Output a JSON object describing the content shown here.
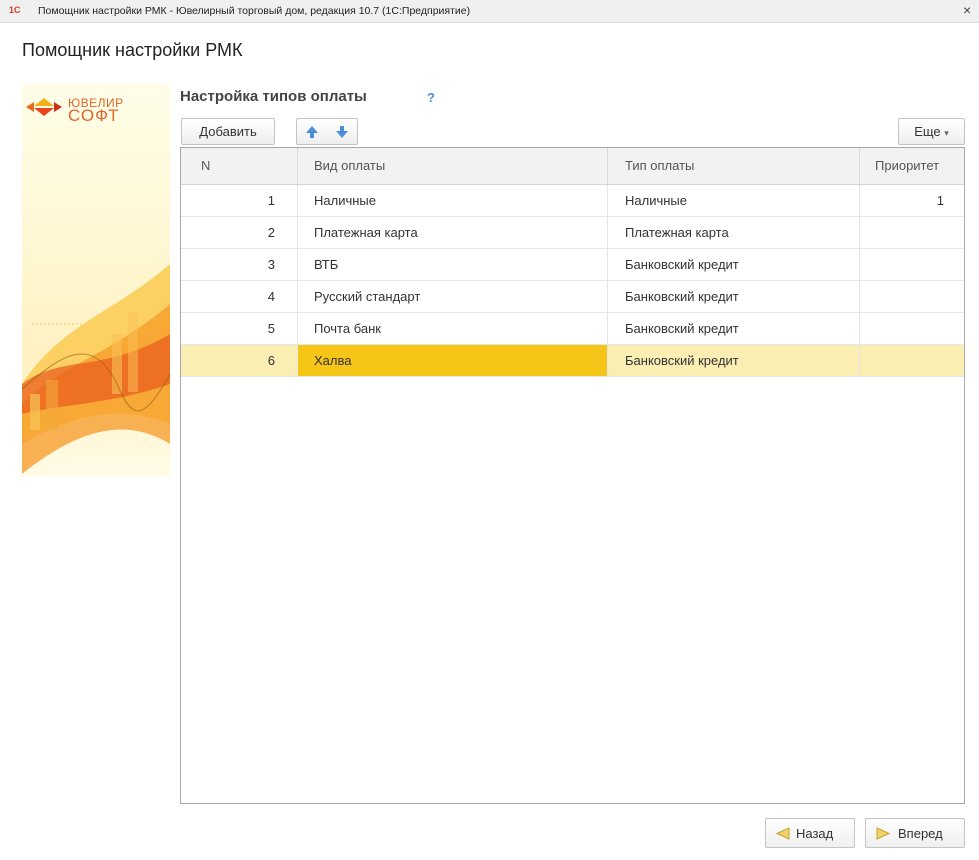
{
  "window": {
    "title": "Помощник настройки РМК - Ювелирный торговый дом, редакция 10.7  (1С:Предприятие)",
    "close_glyph": "×",
    "app_icon": "1С"
  },
  "page_title": "Помощник настройки РМК",
  "logo": {
    "line1": "ЮВЕЛИР",
    "line2": "СОФТ"
  },
  "section": {
    "title": "Настройка типов оплаты",
    "help": "?"
  },
  "toolbar": {
    "add_label": "Добавить",
    "more_label": "Еще",
    "up_icon": "arrow-up-icon",
    "down_icon": "arrow-down-icon"
  },
  "table": {
    "columns": [
      "N",
      "Вид оплаты",
      "Тип оплаты",
      "Приоритет"
    ],
    "rows": [
      {
        "n": "1",
        "vid": "Наличные",
        "tip": "Наличные",
        "priority": "1"
      },
      {
        "n": "2",
        "vid": "Платежная карта",
        "tip": "Платежная карта",
        "priority": ""
      },
      {
        "n": "3",
        "vid": "ВТБ",
        "tip": "Банковский кредит",
        "priority": ""
      },
      {
        "n": "4",
        "vid": "Русский стандарт",
        "tip": "Банковский кредит",
        "priority": ""
      },
      {
        "n": "5",
        "vid": "Почта банк",
        "tip": "Банковский кредит",
        "priority": ""
      },
      {
        "n": "6",
        "vid": "Халва",
        "tip": "Банковский кредит",
        "priority": ""
      }
    ],
    "selected_row": 6
  },
  "footer": {
    "back_label": "Назад",
    "next_label": "Вперед"
  },
  "colors": {
    "selection": "#fbeeb3",
    "selection_cell": "#f5c518",
    "help": "#4a8fd6",
    "logo": "#e2652a"
  }
}
